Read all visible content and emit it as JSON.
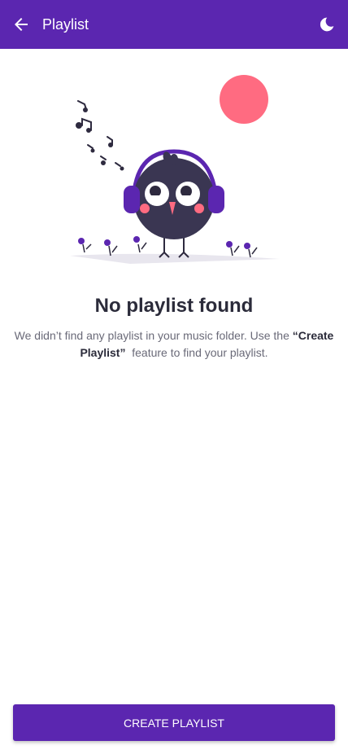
{
  "app_bar": {
    "title": "Playlist",
    "back_icon": "arrow-left-icon",
    "theme_icon": "moon-icon",
    "background": "#5b26b0"
  },
  "empty_state": {
    "heading": "No playlist found",
    "description_before": "We didn’t find any playlist in your music folder. Use the ",
    "description_bold": "“Create Playlist”",
    "description_after": "  feature to find your playlist."
  },
  "actions": {
    "create_label": "CREATE PLAYLIST",
    "button_color": "#5b26b0"
  }
}
